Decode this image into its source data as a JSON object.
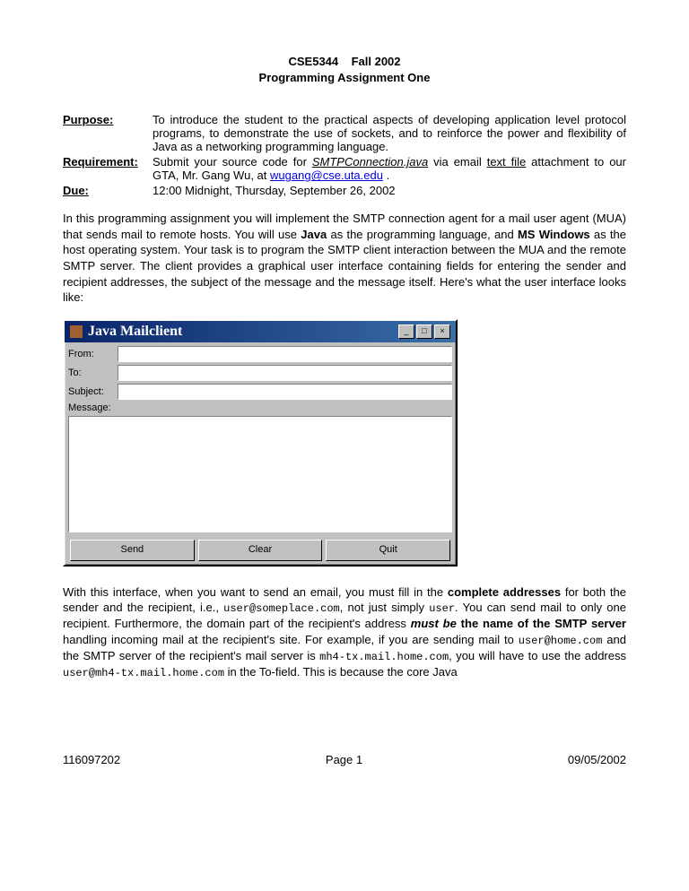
{
  "header": {
    "line1": "CSE5344    Fall 2002",
    "line2": "Programming Assignment One"
  },
  "defs": {
    "purpose_label": "Purpose:",
    "purpose_text": "To introduce the student to the practical aspects of developing application level protocol programs, to demonstrate the use of sockets, and to reinforce the power and flexibility of Java as a networking programming language.",
    "requirement_label": "Requirement:",
    "req_pre": "Submit your source code for ",
    "req_file": "SMTPConnection.java",
    "req_mid": " via email ",
    "req_textfile": "text file",
    "req_post": " attachment to our GTA, Mr. Gang Wu, at ",
    "req_email": "wugang@cse.uta.edu",
    "req_end": " .",
    "due_label": "Due:",
    "due_text": "12:00 Midnight, Thursday, September 26, 2002"
  },
  "body1": {
    "pre": "In this programming assignment you will implement the SMTP connection agent for a mail user agent (MUA) that sends mail to remote hosts. You will use ",
    "java": "Java",
    "mid1": " as the programming language, and ",
    "msw": "MS Windows",
    "post": " as the host operating system.  Your task is to program the SMTP client interaction between the MUA and the remote SMTP server. The client provides a graphical user interface containing fields for entering the sender and recipient addresses, the subject of the message and the message itself. Here's what the user interface looks like:"
  },
  "mailclient": {
    "title": "Java Mailclient",
    "from": "From:",
    "to": "To:",
    "subject": "Subject:",
    "message": "Message:",
    "send": "Send",
    "clear": "Clear",
    "quit": "Quit",
    "min": "_",
    "max": "□",
    "close": "×"
  },
  "body2": {
    "pre": "With this interface, when you want to send an email, you must fill in the ",
    "complete": "complete addresses",
    "mid1": " for both the sender and the recipient, i.e., ",
    "addr1": "user@someplace.com",
    "mid2": ", not just simply ",
    "user": "user",
    "mid3": ". You can send mail to only one recipient. Furthermore, the domain part of the recipient's address ",
    "mustbe": "must be",
    "mid4": " ",
    "servname": "the name of the SMTP server",
    "mid5": " handling incoming mail at the recipient's site.  For example, if you are sending mail to ",
    "addr2": "user@home.com",
    "mid6": " and the SMTP server of the recipient's mail server is ",
    "srv": "mh4-tx.mail.home.com",
    "mid7": ", you will have to use the address ",
    "addr3": "user@mh4-tx.mail.home.com",
    "end": " in the To-field. This is because the core Java"
  },
  "footer": {
    "left": "116097202",
    "center": "Page 1",
    "right": "09/05/2002"
  }
}
